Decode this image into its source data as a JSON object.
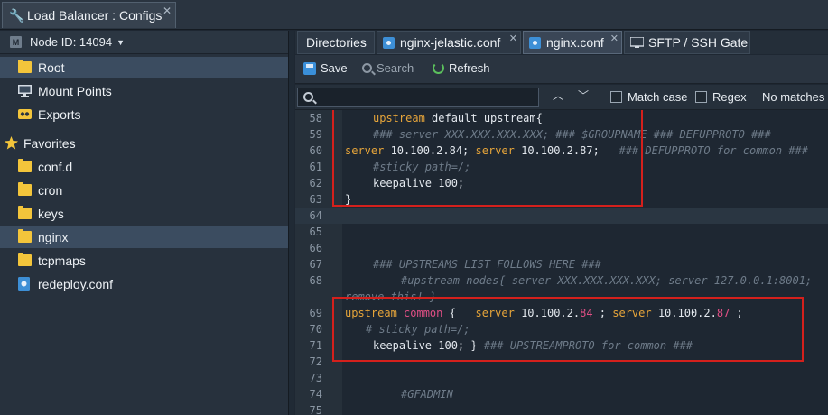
{
  "window": {
    "title": "Load Balancer : Configs",
    "close_glyph": "✕"
  },
  "sidebar": {
    "node_label": "Node ID: 14094",
    "node_badge": "M",
    "items": [
      {
        "label": "Root",
        "icon": "folder-icon",
        "selected": true
      },
      {
        "label": "Mount Points",
        "icon": "monitor-icon"
      },
      {
        "label": "Exports",
        "icon": "exports-icon"
      }
    ],
    "favorites_label": "Favorites",
    "favorites": [
      {
        "label": "conf.d",
        "icon": "folder-icon"
      },
      {
        "label": "cron",
        "icon": "folder-icon"
      },
      {
        "label": "keys",
        "icon": "folder-icon"
      },
      {
        "label": "nginx",
        "icon": "folder-icon",
        "selected": true
      },
      {
        "label": "tcpmaps",
        "icon": "folder-icon"
      },
      {
        "label": "redeploy.conf",
        "icon": "file-icon"
      }
    ]
  },
  "tabs": [
    {
      "label": "Directories"
    },
    {
      "label": "nginx-jelastic.conf"
    },
    {
      "label": "nginx.conf",
      "active": true
    },
    {
      "label": "SFTP / SSH Gate"
    }
  ],
  "toolbar": {
    "save": "Save",
    "search": "Search",
    "refresh": "Refresh"
  },
  "findbar": {
    "placeholder": "",
    "match_case": "Match case",
    "regex": "Regex",
    "status": "No matches",
    "up": "︿",
    "down": "﹀"
  },
  "editor": {
    "lines": [
      {
        "n": "58"
      },
      {
        "n": "59"
      },
      {
        "n": "60"
      },
      {
        "n": "61"
      },
      {
        "n": "62"
      },
      {
        "n": "63"
      },
      {
        "n": "64"
      },
      {
        "n": "65"
      },
      {
        "n": "66"
      },
      {
        "n": "67"
      },
      {
        "n": "68"
      },
      {
        "n": ""
      },
      {
        "n": "69"
      },
      {
        "n": "70"
      },
      {
        "n": "71"
      },
      {
        "n": "72"
      },
      {
        "n": "73"
      },
      {
        "n": "74"
      },
      {
        "n": "75"
      }
    ],
    "code": {
      "l58a": "upstream",
      "l58b": " default_upstream{",
      "l59": "### server XXX.XXX.XXX.XXX; ### $GROUPNAME ### DEFUPPROTO ###",
      "l60a": "server",
      "l60b": " 10.100.2.84; ",
      "l60c": "server",
      "l60d": " 10.100.2.87;",
      "l60e": "   ### DEFUPPROTO for common ###",
      "l61": "#sticky path=/;",
      "l62a": "keepalive",
      "l62b": " 100;",
      "l63": "}",
      "l67": "### UPSTREAMS LIST FOLLOWS HERE ###",
      "l68": "#upstream nodes{ server XXX.XXX.XXX.XXX; server 127.0.0.1:8001;",
      "l68b": "remove this! }",
      "l69a": "upstream",
      "l69b": " common",
      "l69c": " {   ",
      "l69d": "server",
      "l69e": " 10.100.2.",
      "l69f": "84",
      "l69g": " ; ",
      "l69h": "server",
      "l69i": " 10.100.2.",
      "l69j": "87",
      "l69k": " ;",
      "l70": "# sticky path=/;",
      "l71a": "keepalive",
      "l71b": " 100; } ",
      "l71c": "### UPSTREAMPROTO for common ###",
      "l74": "#GFADMIN"
    }
  }
}
